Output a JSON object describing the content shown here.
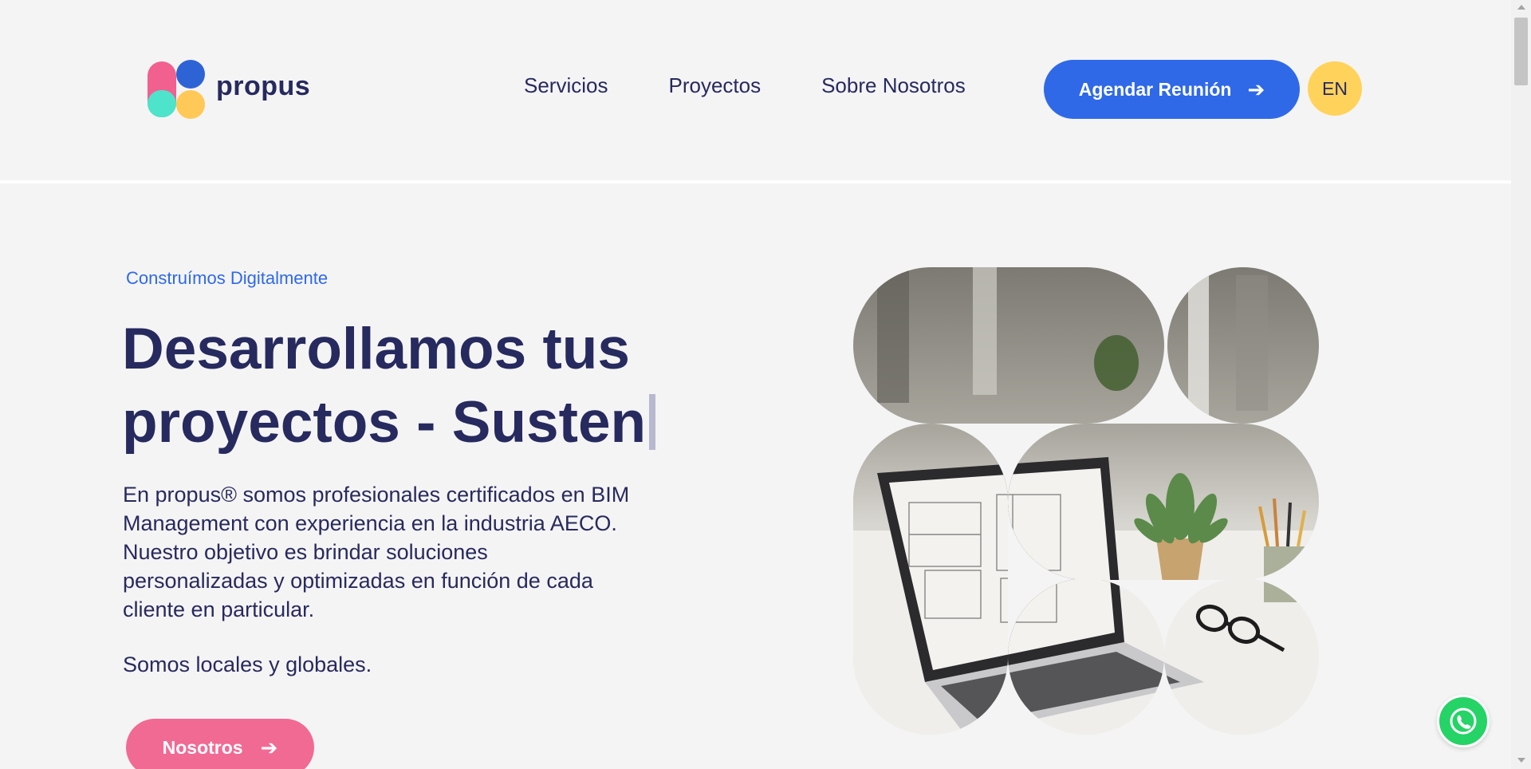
{
  "header": {
    "logo_text": "propus",
    "nav": [
      "Servicios",
      "Proyectos",
      "Sobre Nosotros"
    ],
    "cta_label": "Agendar Reunión",
    "lang_label": "EN"
  },
  "hero": {
    "eyebrow": "Construímos Digitalmente",
    "headline_line1": "Desarrollamos tus",
    "headline_line2": "proyectos - Susten",
    "description": "En propus® somos profesionales certificados en BIM Management con experiencia en la industria AECO. Nuestro objetivo es brindar soluciones personalizadas y optimizadas en función de cada cliente en particular.",
    "description2": "Somos locales y globales.",
    "button_label": "Nosotros"
  },
  "colors": {
    "primary_blue": "#2f69e8",
    "navy": "#272a5e",
    "pink": "#f16a93",
    "yellow": "#ffd25c",
    "teal": "#4ee3cb",
    "whatsapp": "#25d366"
  },
  "icons": [
    "arrow-right-icon",
    "whatsapp-icon"
  ]
}
